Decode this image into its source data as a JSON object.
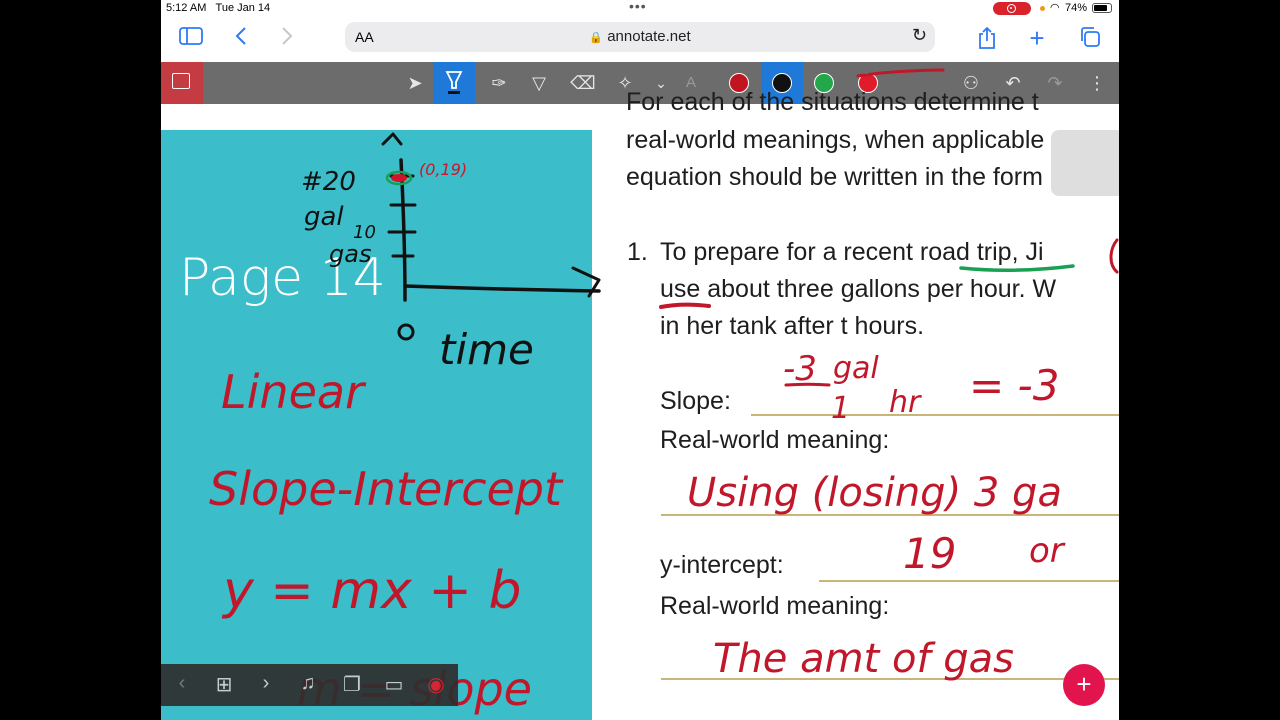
{
  "status_bar": {
    "time": "5:12 AM",
    "date": "Tue Jan 14",
    "battery": "74%"
  },
  "browser": {
    "text_size": "AA",
    "url": "annotate.net"
  },
  "colors": {
    "teal": "#3bbdca",
    "ink_red": "#c0182a",
    "ink_black": "#111111",
    "ink_green": "#1aa052",
    "toolbar": "#6c6c6c",
    "accent": "#1e79d8"
  },
  "toolbar": {
    "swatches": [
      "#c0141f",
      "#111111",
      "#22a84a",
      "#e01b2a"
    ]
  },
  "slide": {
    "label": "Page 14"
  },
  "document": {
    "intro_lines": [
      "For each of the situations determine t",
      "real-world meanings, when applicable",
      "equation should be written in the form"
    ],
    "problem_number": "1.",
    "problem_lines": [
      "To prepare for a recent road trip, Ji",
      "use about three gallons per hour. W",
      "in her tank after t hours."
    ],
    "labels": {
      "slope": "Slope:",
      "meaning1": "Real-world meaning:",
      "y_intercept": "y-intercept:",
      "meaning2": "Real-world meaning:"
    }
  },
  "handwriting": {
    "graph_labels": {
      "y_top": "#20",
      "y_mid1": "gal",
      "y_mid2": "10",
      "y_mid3": "gas",
      "origin": "0",
      "x_axis": "time",
      "point": "(0,19)"
    },
    "notes": [
      "Linear",
      "Slope-Intercept",
      "y = mx + b",
      "m = slope"
    ],
    "slope_work": {
      "numerator": "-3",
      "denominator": "1",
      "units_top": "gal",
      "units_bottom": "hr",
      "result": "= -3"
    },
    "meaning1": "Using (losing) 3 ga",
    "intercept": "19",
    "or_text": "or",
    "meaning2": "The amt of gas"
  }
}
